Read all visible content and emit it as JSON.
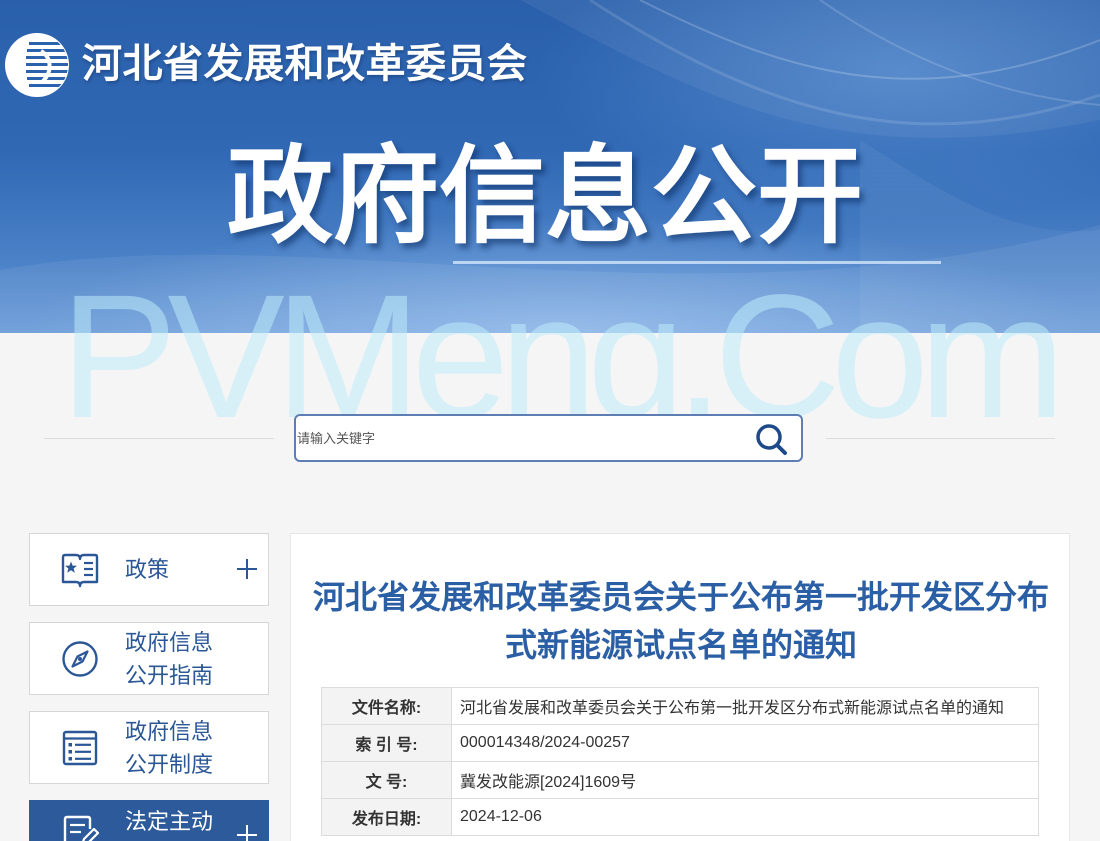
{
  "header": {
    "org_name": "河北省发展和改革委员会",
    "logo_icon": "hebei-ndrc-emblem-icon",
    "page_title": "政府信息公开"
  },
  "watermark": "PVMeng.Com",
  "search": {
    "placeholder": "请输入关键字",
    "icon": "search-icon"
  },
  "sidebar": {
    "items": [
      {
        "lines": [
          "政策"
        ],
        "icon": "policy-book-icon",
        "expand_icon": "plus-icon",
        "active": false
      },
      {
        "lines": [
          "政府信息",
          "公开指南"
        ],
        "icon": "compass-icon",
        "active": false
      },
      {
        "lines": [
          "政府信息",
          "公开制度"
        ],
        "icon": "list-document-icon",
        "active": false
      },
      {
        "lines": [
          "法定主动"
        ],
        "icon": "edit-document-icon",
        "expand_icon": "plus-icon",
        "active": true
      }
    ]
  },
  "article": {
    "title": "河北省发展和改革委员会关于公布第一批开发区分布式新能源试点名单的通知",
    "meta": [
      {
        "label": "文件名称:",
        "value": "河北省发展和改革委员会关于公布第一批开发区分布式新能源试点名单的通知"
      },
      {
        "label": "索 引 号:",
        "value": "000014348/2024-00257"
      },
      {
        "label": "文 号:",
        "value": "冀发改能源[2024]1609号"
      },
      {
        "label": "发布日期:",
        "value": "2024-12-06"
      }
    ]
  },
  "colors": {
    "banner_blue": "#2a60ab",
    "nav_text_blue": "#2b5797",
    "title_blue": "#2a5ea5",
    "active_nav_bg": "#2c5a9a",
    "search_border": "#5d7db3",
    "page_bg": "#f5f5f5"
  }
}
